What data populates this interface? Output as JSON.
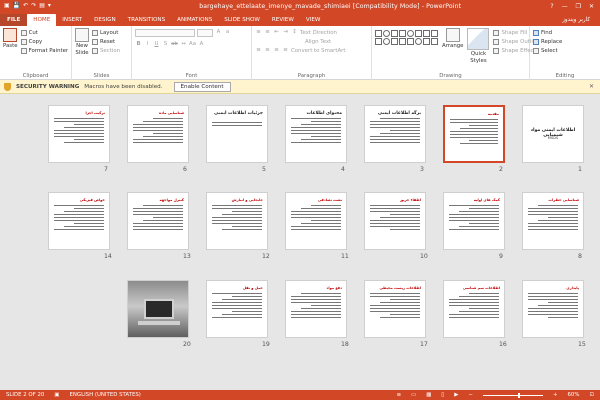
{
  "window": {
    "title": "bargehaye_ettelaate_imenye_mavade_shimiaei [Compatibility Mode] - PowerPoint",
    "controls": [
      "?",
      "—",
      "❐",
      "✕"
    ]
  },
  "tabs": [
    {
      "label": "FILE",
      "key": "file"
    },
    {
      "label": "HOME",
      "key": "home"
    },
    {
      "label": "INSERT",
      "key": "insert"
    },
    {
      "label": "DESIGN",
      "key": "design"
    },
    {
      "label": "TRANSITIONS",
      "key": "transitions"
    },
    {
      "label": "ANIMATIONS",
      "key": "animations"
    },
    {
      "label": "SLIDE SHOW",
      "key": "slideshow"
    },
    {
      "label": "REVIEW",
      "key": "review"
    },
    {
      "label": "VIEW",
      "key": "view"
    }
  ],
  "user_name": "کاربر ویندوز",
  "ribbon": {
    "clipboard": {
      "label": "Clipboard",
      "paste": "Paste",
      "cut": "Cut",
      "copy": "Copy",
      "format_painter": "Format Painter"
    },
    "slides": {
      "label": "Slides",
      "new_slide": "New",
      "new_slide2": "Slide",
      "layout": "Layout",
      "reset": "Reset",
      "section": "Section"
    },
    "font": {
      "label": "Font"
    },
    "paragraph": {
      "label": "Paragraph",
      "text_direction": "Text Direction",
      "align_text": "Align Text",
      "convert_smartart": "Convert to SmartArt"
    },
    "drawing": {
      "label": "Drawing",
      "arrange": "Arrange",
      "quick_styles": "Quick",
      "quick_styles2": "Styles",
      "shape_fill": "Shape Fill",
      "shape_outline": "Shape Outline",
      "shape_effects": "Shape Effects"
    },
    "editing": {
      "label": "Editing",
      "find": "Find",
      "replace": "Replace",
      "select": "Select"
    }
  },
  "security_bar": {
    "title": "SECURITY WARNING",
    "message": "Macros have been disabled.",
    "button": "Enable Content"
  },
  "slides": [
    {
      "n": "1",
      "kind": "title",
      "title": "اطلاعات ایمنی مواد شیمیایی",
      "sub": "MSDS"
    },
    {
      "n": "2",
      "kind": "text",
      "title": "مقدمه",
      "selected": true
    },
    {
      "n": "3",
      "kind": "text",
      "title": "برگه اطلاعات ایمنی"
    },
    {
      "n": "4",
      "kind": "text",
      "title": "محتوای اطلاعات"
    },
    {
      "n": "5",
      "kind": "quote",
      "title": "جزئیات اطلاعات ایمنی"
    },
    {
      "n": "6",
      "kind": "text",
      "title": "شناسایی ماده"
    },
    {
      "n": "7",
      "kind": "text",
      "title": "ترکیب اجزا"
    },
    {
      "n": "8",
      "kind": "text",
      "title": "شناسایی خطرات"
    },
    {
      "n": "9",
      "kind": "text",
      "title": "کمک های اولیه"
    },
    {
      "n": "10",
      "kind": "text",
      "title": "اطفاء حریق"
    },
    {
      "n": "11",
      "kind": "text",
      "title": "نشت تصادفی"
    },
    {
      "n": "12",
      "kind": "text",
      "title": "جابجایی و انبارش"
    },
    {
      "n": "13",
      "kind": "text",
      "title": "کنترل مواجهه"
    },
    {
      "n": "14",
      "kind": "text",
      "title": "خواص فیزیکی"
    },
    {
      "n": "15",
      "kind": "text",
      "title": "پایداری"
    },
    {
      "n": "16",
      "kind": "text",
      "title": "اطلاعات سم شناسی"
    },
    {
      "n": "17",
      "kind": "text",
      "title": "اطلاعات زیست محیطی"
    },
    {
      "n": "18",
      "kind": "text",
      "title": "دفع مواد"
    },
    {
      "n": "19",
      "kind": "text",
      "title": "حمل و نقل"
    },
    {
      "n": "20",
      "kind": "photo",
      "title": ""
    }
  ],
  "status": {
    "slide_of": "SLIDE 2 OF 20",
    "language": "ENGLISH (UNITED STATES)",
    "zoom": "60%",
    "zoom_fraction": 0.6
  },
  "colors": {
    "accent": "#d24726",
    "warning_bg": "#fff4ce",
    "title_red": "#c00000"
  }
}
